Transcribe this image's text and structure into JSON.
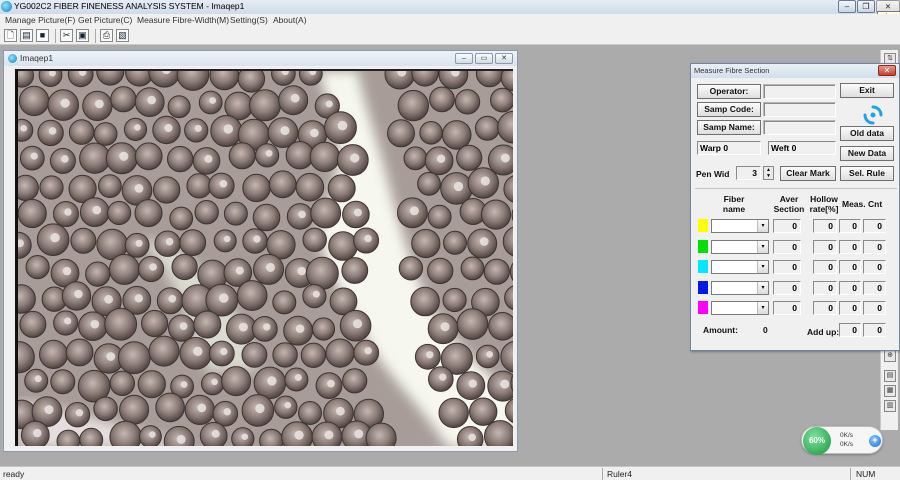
{
  "app": {
    "title": "YG002C2 FIBER FINENESS ANALYSIS SYSTEM - Imaqep1",
    "close_tooltip": "Close"
  },
  "window_controls": {
    "min": "–",
    "restore": "❐",
    "close": "✕"
  },
  "menu": {
    "items": [
      "Manage Picture(F)",
      "Get Picture(C)",
      "Measure Fibre-Width(M)",
      "Setting(S)",
      "About(A)"
    ]
  },
  "toolbar": {
    "icons": [
      "new-file-icon",
      "open-folder-icon",
      "save-icon",
      "tools-icon",
      "capture-icon",
      "print-icon",
      "print-preview-icon"
    ]
  },
  "image_window": {
    "title": "Imaqep1",
    "controls": {
      "min": "–",
      "restore": "▭",
      "close": "✕"
    }
  },
  "dialog": {
    "title": "Measure Fibre Section",
    "close": "✕",
    "operator_btn": "Operator:",
    "samp_code_btn": "Samp Code:",
    "samp_name_btn": "Samp Name:",
    "exit_btn": "Exit",
    "old_data_btn": "Old data",
    "new_data_btn": "New Data",
    "sel_rule_btn": "Sel. Rule",
    "clear_mark_btn": "Clear Mark",
    "warp_label": "Warp",
    "warp_value": "0",
    "weft_label": "Weft",
    "weft_value": "0",
    "pen_wid_label": "Pen Wid",
    "pen_wid_value": "3",
    "headers": {
      "fiber_name": "Fiber name",
      "aver_section": "Aver Section",
      "hollow_rate": "Hollow rate[%]",
      "meas_cnt": "Meas. Cnt"
    },
    "rows": [
      {
        "color": "#ffff00",
        "aver": "0",
        "hollow": "0",
        "cnt1": "0",
        "cnt2": "0"
      },
      {
        "color": "#00e000",
        "aver": "0",
        "hollow": "0",
        "cnt1": "0",
        "cnt2": "0"
      },
      {
        "color": "#00e8ff",
        "aver": "0",
        "hollow": "0",
        "cnt1": "0",
        "cnt2": "0"
      },
      {
        "color": "#0018e8",
        "aver": "0",
        "hollow": "0",
        "cnt1": "0",
        "cnt2": "0"
      },
      {
        "color": "#ff00ff",
        "aver": "0",
        "hollow": "0",
        "cnt1": "0",
        "cnt2": "0"
      }
    ],
    "amount_label": "Amount:",
    "amount_value": "0",
    "add_up_label": "Add up:",
    "add_up_value1": "0",
    "add_up_value2": "0"
  },
  "status": {
    "ready": "ready",
    "ruler": "Ruler4",
    "num": "NUM"
  },
  "net_widget": {
    "percent": "60%",
    "up": "0K/s",
    "down": "0K/s"
  }
}
